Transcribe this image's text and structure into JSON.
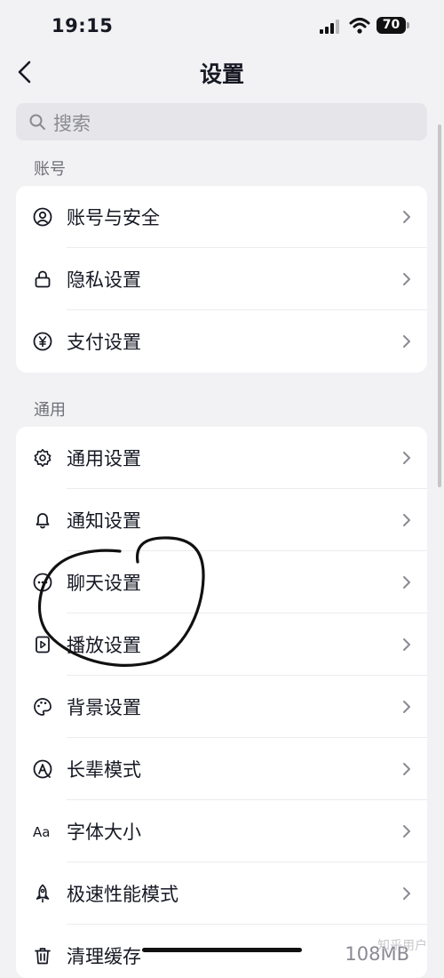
{
  "status_bar": {
    "time": "19:15",
    "battery": "70"
  },
  "nav": {
    "title": "设置"
  },
  "search": {
    "placeholder": "搜索"
  },
  "sections": [
    {
      "title": "账号",
      "items": [
        {
          "label": "账号与安全",
          "icon": "user-circle-icon"
        },
        {
          "label": "隐私设置",
          "icon": "lock-icon"
        },
        {
          "label": "支付设置",
          "icon": "yen-icon"
        }
      ]
    },
    {
      "title": "通用",
      "items": [
        {
          "label": "通用设置",
          "icon": "gear-icon"
        },
        {
          "label": "通知设置",
          "icon": "bell-icon"
        },
        {
          "label": "聊天设置",
          "icon": "chat-icon"
        },
        {
          "label": "播放设置",
          "icon": "play-icon"
        },
        {
          "label": "背景设置",
          "icon": "palette-icon"
        },
        {
          "label": "长辈模式",
          "icon": "elder-mode-icon"
        },
        {
          "label": "字体大小",
          "icon": "font-size-icon",
          "icon_text": "Aa"
        },
        {
          "label": "极速性能模式",
          "icon": "rocket-icon"
        },
        {
          "label": "清理缓存",
          "icon": "trash-icon",
          "value": "108MB"
        }
      ]
    }
  ],
  "watermark": "知乎用户"
}
